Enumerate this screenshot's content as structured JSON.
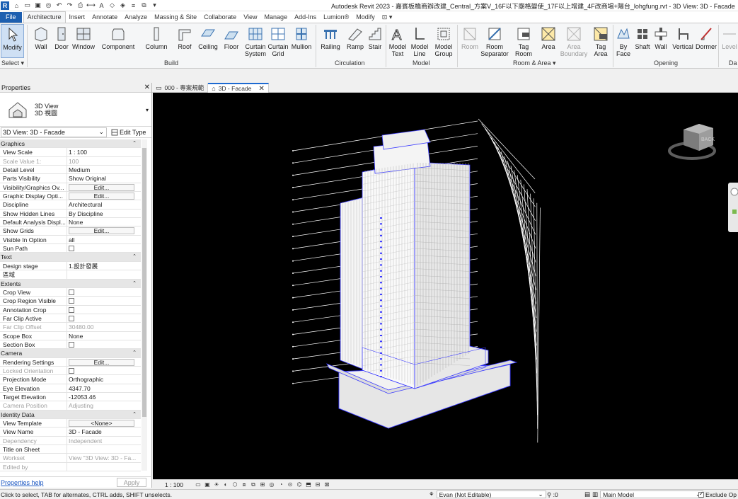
{
  "window": {
    "app_logo": "R",
    "title": "Autodesk Revit 2023 - 嘉賓板橋商辦改建_Central_方案V_16F以下廟格變使_17F以上增建_4F改商場+陽台_lohgfung.rvt - 3D View: 3D - Facade"
  },
  "ribbon_tabs": [
    "File",
    "Architecture",
    "Insert",
    "Annotate",
    "Analyze",
    "Massing & Site",
    "Collaborate",
    "View",
    "Manage",
    "Add-Ins",
    "Lumion®",
    "Modify",
    "⊡ ▾"
  ],
  "ribbon": {
    "select": {
      "modify": "Modify",
      "select_label": "Select ▾"
    },
    "build": {
      "label": "Build",
      "buttons": [
        "Wall",
        "Door",
        "Window",
        "Component",
        "Column",
        "Roof",
        "Ceiling",
        "Floor",
        "Curtain\nSystem",
        "Curtain\nGrid",
        "Mullion"
      ]
    },
    "circulation": {
      "label": "Circulation",
      "buttons": [
        "Railing",
        "Ramp",
        "Stair"
      ]
    },
    "model": {
      "label": "Model",
      "buttons": [
        "Model\nText",
        "Model\nLine",
        "Model\nGroup"
      ]
    },
    "room_area": {
      "label": "Room & Area ▾",
      "buttons": [
        "Room",
        "Room\nSeparator",
        "Tag\nRoom",
        "Area",
        "Area\nBoundary",
        "Tag\nArea"
      ]
    },
    "opening": {
      "label": "Opening",
      "buttons": [
        "By\nFace",
        "Shaft",
        "Wall",
        "Vertical",
        "Dormer"
      ]
    },
    "datum": {
      "partial_label": "Da",
      "partial_button": "Level"
    }
  },
  "properties": {
    "header": "Properties",
    "close": "✕",
    "type_line1": "3D View",
    "type_line2": "3D 視圖",
    "instance_selector": "3D View: 3D - Facade",
    "edit_type": "Edit Type",
    "rows": [
      {
        "g": true,
        "k": "Graphics"
      },
      {
        "k": "View Scale",
        "v": "1 : 100"
      },
      {
        "k": "Scale Value    1:",
        "v": "100",
        "dis": true
      },
      {
        "k": "Detail Level",
        "v": "Medium"
      },
      {
        "k": "Parts Visibility",
        "v": "Show Original"
      },
      {
        "k": "Visibility/Graphics Ov...",
        "btn": "Edit..."
      },
      {
        "k": "Graphic Display Opti...",
        "btn": "Edit..."
      },
      {
        "k": "Discipline",
        "v": "Architectural"
      },
      {
        "k": "Show Hidden Lines",
        "v": "By Discipline"
      },
      {
        "k": "Default Analysis Displ...",
        "v": "None"
      },
      {
        "k": "Show Grids",
        "btn": "Edit..."
      },
      {
        "k": "Visible In Option",
        "v": "all"
      },
      {
        "k": "Sun Path",
        "chk": true
      },
      {
        "g": true,
        "k": "Text"
      },
      {
        "k": "Design stage",
        "v": "1.設計發展"
      },
      {
        "k": "區域",
        "v": ""
      },
      {
        "g": true,
        "k": "Extents"
      },
      {
        "k": "Crop View",
        "chk": true
      },
      {
        "k": "Crop Region Visible",
        "chk": true
      },
      {
        "k": "Annotation Crop",
        "chk": true
      },
      {
        "k": "Far Clip Active",
        "chk": true
      },
      {
        "k": "Far Clip Offset",
        "v": "30480.00",
        "dis": true
      },
      {
        "k": "Scope Box",
        "v": "None"
      },
      {
        "k": "Section Box",
        "chk": true
      },
      {
        "g": true,
        "k": "Camera"
      },
      {
        "k": "Rendering Settings",
        "btn": "Edit..."
      },
      {
        "k": "Locked Orientation",
        "chk": true,
        "dis": true
      },
      {
        "k": "Projection Mode",
        "v": "Orthographic"
      },
      {
        "k": "Eye Elevation",
        "v": "4347.70"
      },
      {
        "k": "Target Elevation",
        "v": "-12053.46"
      },
      {
        "k": "Camera Position",
        "v": "Adjusting",
        "dis": true
      },
      {
        "g": true,
        "k": "Identity Data"
      },
      {
        "k": "View Template",
        "btn": "<None>"
      },
      {
        "k": "View Name",
        "v": "3D - Facade"
      },
      {
        "k": "Dependency",
        "v": "Independent",
        "dis": true
      },
      {
        "k": "Title on Sheet",
        "v": ""
      },
      {
        "k": "Workset",
        "v": "View \"3D View: 3D - Fa...",
        "dis": true
      },
      {
        "k": "Edited by",
        "v": "",
        "dis": true
      }
    ],
    "help_link": "Properties help",
    "apply": "Apply"
  },
  "view_tabs": [
    {
      "label": "000 - 專案規範",
      "icon": "floor-plan-icon",
      "active": false
    },
    {
      "label": "3D - Facade",
      "icon": "3d-view-icon",
      "active": true
    }
  ],
  "view_bar": {
    "scale": "1 : 100"
  },
  "status": {
    "message": "Click to select, TAB for alternates, CTRL adds, SHIFT unselects.",
    "workset": "Evan (Not Editable)",
    "count": ":0",
    "model": "Main Model",
    "exclude": "Exclude Op"
  },
  "viewcube": {
    "face": "BACK"
  },
  "colors": {
    "canvas": "#000000",
    "building": "#ffffff",
    "selection": "#3a3aff",
    "file_tab": "#1d5fb0"
  }
}
